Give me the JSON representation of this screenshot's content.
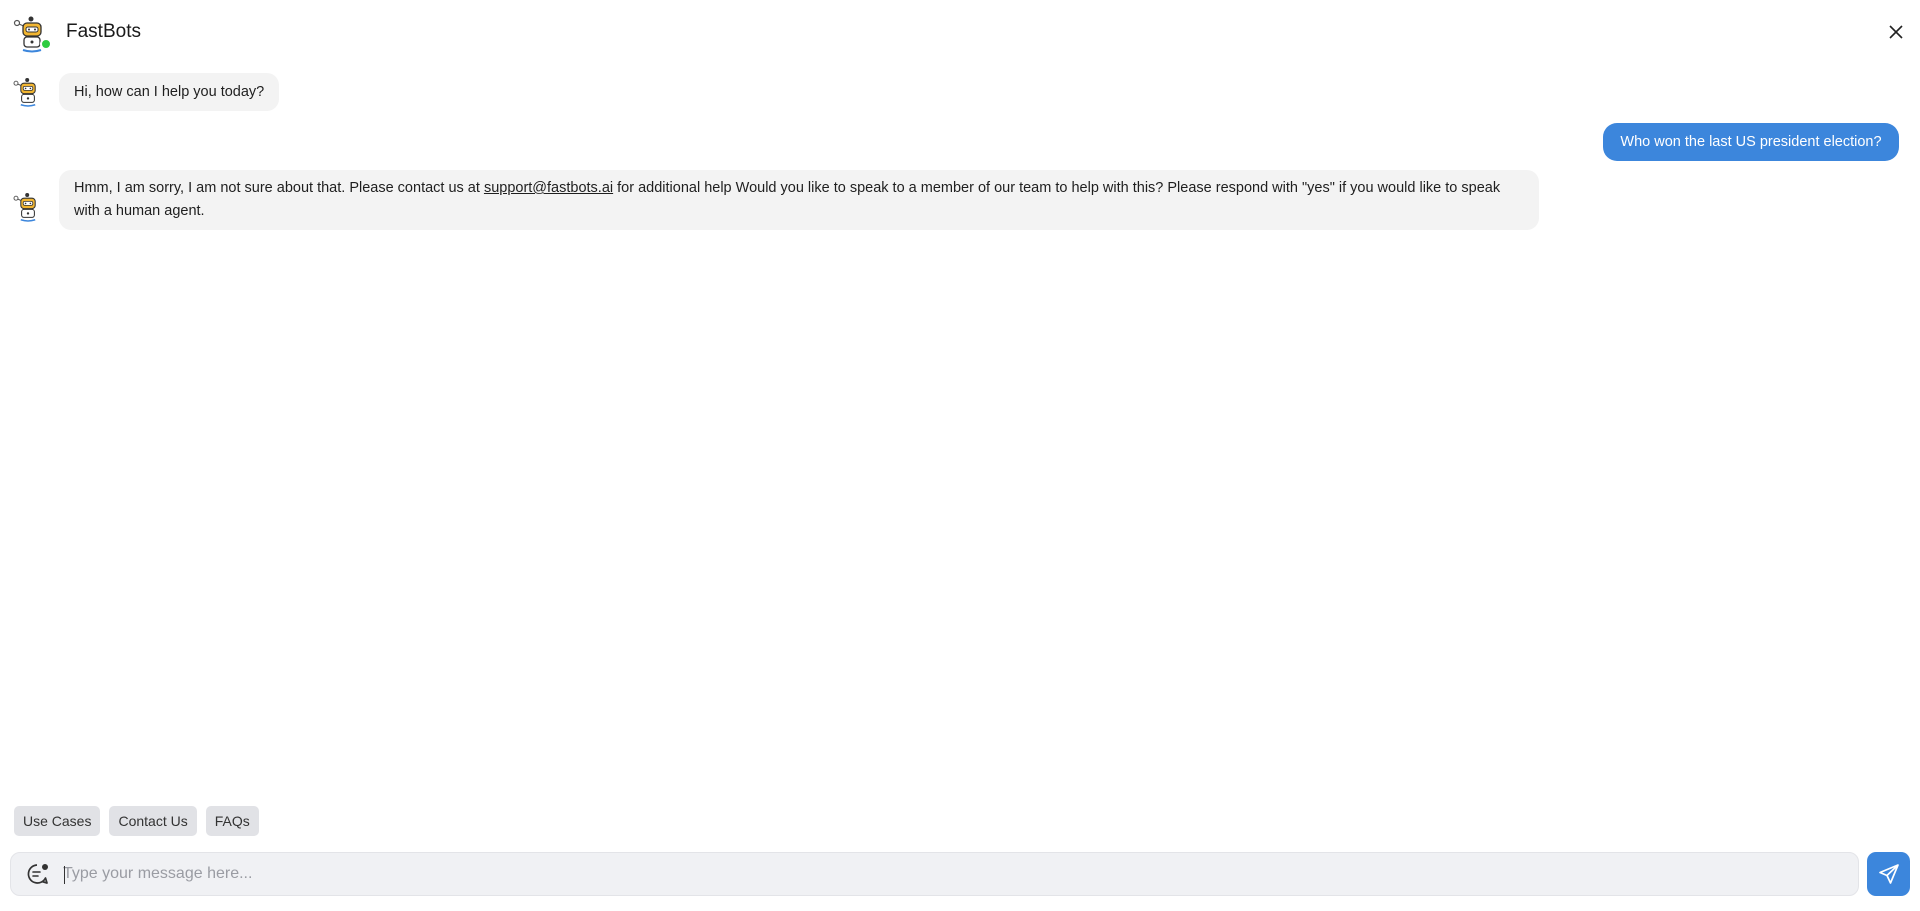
{
  "header": {
    "title": "FastBots",
    "avatar_icon": "robot-avatar-icon",
    "status_color": "#2ecc40",
    "close_icon": "close-icon"
  },
  "messages": [
    {
      "role": "bot",
      "text": "Hi, how can I help you today?"
    },
    {
      "role": "user",
      "text": "Who won the last US president election?"
    },
    {
      "role": "bot",
      "text_before": "Hmm, I am sorry, I am not sure about that. Please contact us at ",
      "link": "support@fastbots.ai",
      "text_after": " for additional help Would you like to speak to a member of our team to help with this? Please respond with \"yes\" if you would like to speak with a human agent."
    }
  ],
  "quick_replies": [
    "Use Cases",
    "Contact Us",
    "FAQs"
  ],
  "composer": {
    "placeholder": "Type your message here...",
    "value": "",
    "emoji_icon": "chat-bubble-icon",
    "send_icon": "send-icon"
  },
  "colors": {
    "accent": "#3c86dc",
    "bot_bubble": "#f3f3f3",
    "chip_bg": "#e1e2e6"
  }
}
